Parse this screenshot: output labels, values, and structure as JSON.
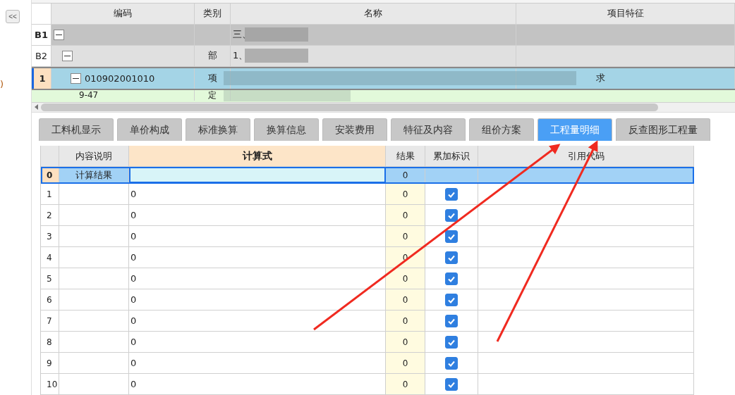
{
  "side_panel": {
    "collapse_button": "<<",
    "fragment": ")"
  },
  "top_grid": {
    "columns": [
      "编码",
      "类别",
      "名称",
      "项目特征"
    ],
    "rows": [
      {
        "row_label": "B1",
        "kind": "section",
        "expanded": true,
        "code": "",
        "type": "",
        "name": "三、",
        "feature": "",
        "selected": false,
        "blurred": true
      },
      {
        "row_label": "B2",
        "kind": "part",
        "expanded": true,
        "code": "",
        "type": "部",
        "name": "1、",
        "feature": "",
        "selected": false,
        "blurred": true
      },
      {
        "row_label": "1",
        "kind": "item",
        "expanded": true,
        "code": "010902001010",
        "type": "项",
        "name": "",
        "feature": "求",
        "selected": true,
        "blurred": true
      },
      {
        "row_label": "",
        "kind": "quota",
        "code": "9-47",
        "type": "定",
        "name": "",
        "feature": "",
        "selected": false,
        "blurred": true
      }
    ]
  },
  "tabs": [
    {
      "label": "工料机显示",
      "selected": false
    },
    {
      "label": "单价构成",
      "selected": false
    },
    {
      "label": "标准换算",
      "selected": false
    },
    {
      "label": "换算信息",
      "selected": false
    },
    {
      "label": "安装费用",
      "selected": false
    },
    {
      "label": "特征及内容",
      "selected": false
    },
    {
      "label": "组价方案",
      "selected": false
    },
    {
      "label": "工程量明细",
      "selected": true
    },
    {
      "label": "反查图形工程量",
      "selected": false
    }
  ],
  "detail_grid": {
    "columns": [
      "内容说明",
      "计算式",
      "结果",
      "累加标识",
      "引用代码"
    ],
    "rows": [
      {
        "index": "0",
        "kind": "total",
        "description": "计算结果",
        "formula": "",
        "result": "0",
        "selected": true
      },
      {
        "index": "1",
        "kind": "line",
        "description": "",
        "formula": "0",
        "result": "0",
        "checked": true,
        "selected": false
      },
      {
        "index": "2",
        "kind": "line",
        "description": "",
        "formula": "0",
        "result": "0",
        "checked": true,
        "selected": false
      },
      {
        "index": "3",
        "kind": "line",
        "description": "",
        "formula": "0",
        "result": "0",
        "checked": true,
        "selected": false
      },
      {
        "index": "4",
        "kind": "line",
        "description": "",
        "formula": "0",
        "result": "0",
        "checked": true,
        "selected": false
      },
      {
        "index": "5",
        "kind": "line",
        "description": "",
        "formula": "0",
        "result": "0",
        "checked": true,
        "selected": false
      },
      {
        "index": "6",
        "kind": "line",
        "description": "",
        "formula": "0",
        "result": "0",
        "checked": true,
        "selected": false
      },
      {
        "index": "7",
        "kind": "line",
        "description": "",
        "formula": "0",
        "result": "0",
        "checked": true,
        "selected": false
      },
      {
        "index": "8",
        "kind": "line",
        "description": "",
        "formula": "0",
        "result": "0",
        "checked": true,
        "selected": false
      },
      {
        "index": "9",
        "kind": "line",
        "description": "",
        "formula": "0",
        "result": "0",
        "checked": true,
        "selected": false
      },
      {
        "index": "10",
        "kind": "line",
        "description": "",
        "formula": "0",
        "result": "0",
        "checked": true,
        "selected": false
      }
    ]
  },
  "annotations": [
    {
      "kind": "arrow"
    },
    {
      "kind": "arrow"
    }
  ]
}
